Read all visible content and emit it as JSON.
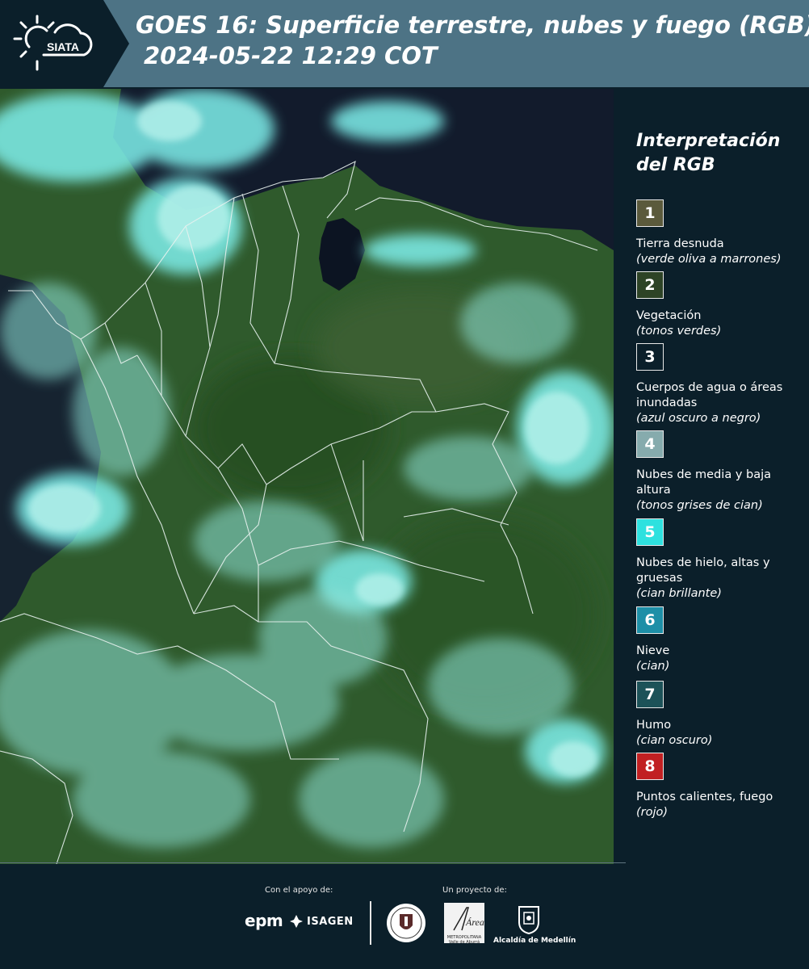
{
  "header": {
    "logo_text": "SIATA",
    "title_line1": "GOES 16: Superficie terrestre, nubes y fuego (RGB)",
    "title_line2": "2024-05-22 12:29 COT"
  },
  "legend": {
    "title": "Interpretación del RGB",
    "items": [
      {
        "number": "1",
        "label": "Tierra desnuda",
        "sublabel": "(verde oliva a marrones)",
        "color": "#5b5a3c"
      },
      {
        "number": "2",
        "label": "Vegetación",
        "sublabel": "(tonos verdes)",
        "color": "#2d4326"
      },
      {
        "number": "3",
        "label": "Cuerpos de agua o áreas inundadas",
        "sublabel": "(azul oscuro a negro)",
        "color": "#0b1f2a"
      },
      {
        "number": "4",
        "label": "Nubes de media y baja altura",
        "sublabel": "(tonos grises de cian)",
        "color": "#86abad"
      },
      {
        "number": "5",
        "label": "Nubes de hielo, altas y gruesas",
        "sublabel": "(cian brillante)",
        "color": "#2ee1df"
      },
      {
        "number": "6",
        "label": "Nieve",
        "sublabel": "(cian)",
        "color": "#1d8fa7"
      },
      {
        "number": "7",
        "label": "Humo",
        "sublabel": "(cian oscuro)",
        "color": "#1c5258"
      },
      {
        "number": "8",
        "label": "Puntos calientes, fuego",
        "sublabel": "(rojo)",
        "color": "#c12022"
      }
    ]
  },
  "footer": {
    "support_label": "Con el apoyo de:",
    "project_label": "Un proyecto de:",
    "sponsor_epm": "epm",
    "sponsor_isagen": "ISAGEN",
    "partner_amva": "Área",
    "partner_amva_caption": "METROPOLITANA Valle de Aburrá",
    "partner_alcaldia": "Alcaldía de Medellín"
  },
  "colors": {
    "background": "#0b1f2a",
    "header_band": "#4d7385",
    "vegetation": "#2f5a2c",
    "cloud_cyan": "#7ff0ec",
    "water": "#121b2c"
  }
}
